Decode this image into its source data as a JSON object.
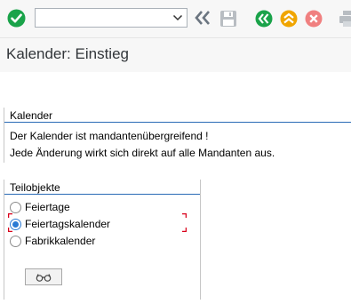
{
  "toolbar": {
    "command_field_value": "",
    "icons": {
      "enter": "check-icon",
      "command_dropdown": "chevron-down-icon",
      "collapse": "double-chevron-left-icon",
      "save": "save-icon",
      "back": "back-icon",
      "exit": "exit-icon",
      "cancel": "cancel-icon",
      "print": "print-icon"
    },
    "colors": {
      "enter": "#1aa34a",
      "back": "#1aa34a",
      "exit": "#f0a500",
      "cancel": "#e84a4a",
      "disabled": "#b8bdc2"
    }
  },
  "page": {
    "title": "Kalender: Einstieg"
  },
  "kalender_group": {
    "header": "Kalender",
    "line1": "Der Kalender ist mandantenübergreifend !",
    "line2": "Jede Änderung wirkt sich direkt auf alle Mandanten aus."
  },
  "teilobjekte_group": {
    "header": "Teilobjekte",
    "options": [
      {
        "label": "Feiertage",
        "checked": false
      },
      {
        "label": "Feiertagskalender",
        "checked": true
      },
      {
        "label": "Fabrikkalender",
        "checked": false
      }
    ],
    "display_button_icon": "glasses-icon"
  },
  "accent_color": "#2a6bb5",
  "focus_color": "#d9001b"
}
